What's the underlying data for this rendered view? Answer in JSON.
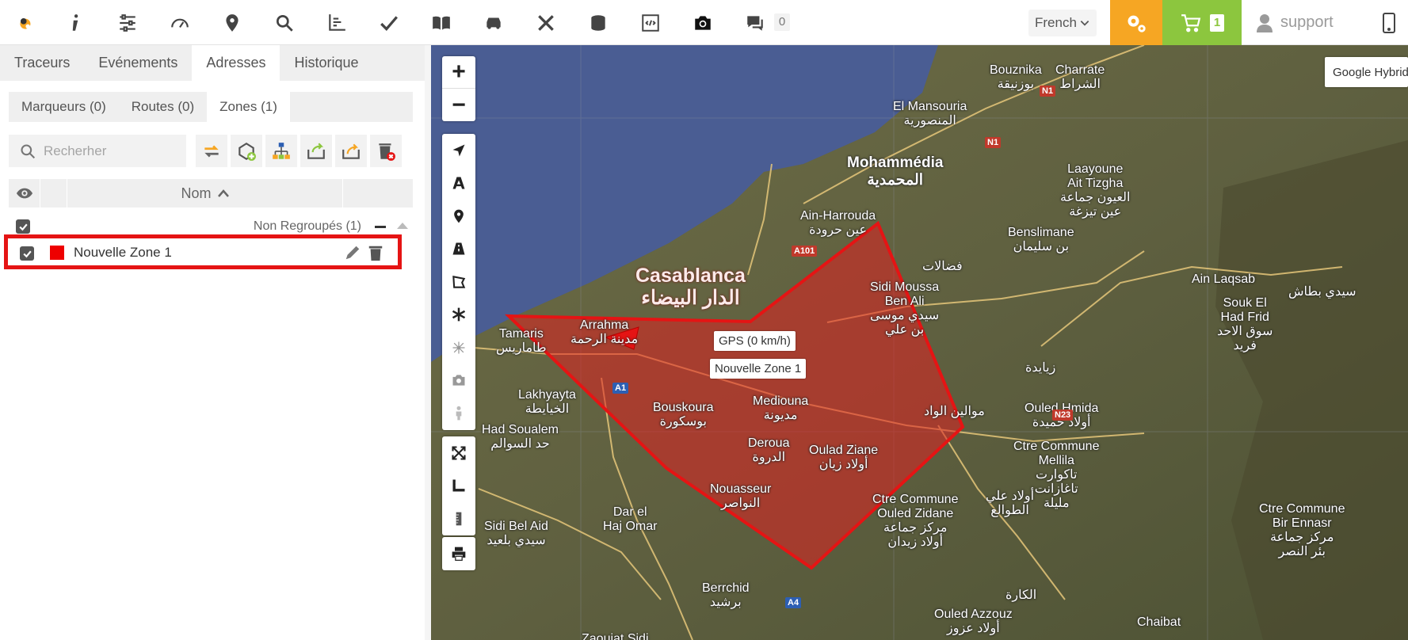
{
  "topbar": {
    "icons": [
      "logo-icon",
      "info-icon",
      "sliders-icon",
      "speedometer-icon",
      "map-pin-icon",
      "search-icon",
      "chart-axes-icon",
      "checkmark-icon",
      "book-icon",
      "car-icon",
      "tools-icon",
      "coins-icon",
      "code-icon",
      "camera-icon",
      "chat-icon"
    ],
    "notifications_count": "0",
    "language": "French",
    "cart_count": "1",
    "username": "support",
    "colors": {
      "config": "#f6a623",
      "cart": "#8cc63e"
    }
  },
  "sidebar": {
    "main_tabs": [
      "Traceurs",
      "Evénements",
      "Adresses",
      "Historique"
    ],
    "active_main_tab": "Adresses",
    "sub_tabs": [
      "Marqueurs (0)",
      "Routes (0)",
      "Zones (1)"
    ],
    "active_sub_tab": "Zones (1)",
    "search_placeholder": "Recherher",
    "toolbar_icons": [
      "refresh-icon",
      "add-zone-icon",
      "hierarchy-icon",
      "import-icon",
      "export-icon",
      "delete-all-icon"
    ],
    "list_header": {
      "name_col": "Nom",
      "sort": "ascending"
    },
    "group": {
      "label": "Non Regroupés (1)",
      "checked": true
    },
    "zones": [
      {
        "name": "Nouvelle Zone 1",
        "color": "#ee0000",
        "checked": true
      }
    ]
  },
  "map": {
    "map_type": "Google Hybrid",
    "toolbar_icons": [
      "locate-arrow-icon",
      "text-icon",
      "marker-icon",
      "road-icon",
      "polygon-icon",
      "asterisk-icon",
      "network-icon",
      "camera-icon",
      "person-icon"
    ],
    "extra_tools": [
      "fullscreen-icon",
      "ruler-icon",
      "measure-icon"
    ],
    "print_icon": "printer-icon",
    "zoom_in": "+",
    "zoom_out": "−",
    "vehicle_tooltip": "GPS (0 km/h)",
    "zone_tooltip": "Nouvelle Zone 1",
    "place_labels": [
      {
        "id": "bouznika",
        "text": "Bouznika\nبوزنيقة"
      },
      {
        "id": "charrate",
        "text": "Charrate\nالشراط"
      },
      {
        "id": "mansouria",
        "text": "El Mansouria\nالمنصورية"
      },
      {
        "id": "mohammedia",
        "text": "Mohammédia\nالمحمدية"
      },
      {
        "id": "laayoune",
        "text": "Laayoune\nAit Tizgha\nالعيون جماعة\nعين تيزغة"
      },
      {
        "id": "ainharrouda",
        "text": "Ain-Harrouda\nعين حرودة"
      },
      {
        "id": "benslimane",
        "text": "Benslimane\nبن سليمان"
      },
      {
        "id": "fadalat",
        "text": "فضالات"
      },
      {
        "id": "ainlaqsab",
        "text": "Ain Laqsab"
      },
      {
        "id": "soukel",
        "text": "Souk El\nHad Frid\nسوق الاحد\nفريد"
      },
      {
        "id": "sidibettache",
        "text": "سيدي بطاش"
      },
      {
        "id": "sidimoussa",
        "text": "Sidi Moussa\nBen Ali\nسيدي موسى\nبن علي"
      },
      {
        "id": "casablanca",
        "text": "Casablanca\nالدار البيضاء"
      },
      {
        "id": "tamaris",
        "text": "Tamaris\nطاماريس"
      },
      {
        "id": "arrahma",
        "text": "Arrahma\nمدينة الرحمة"
      },
      {
        "id": "zyayda",
        "text": "زيايدة"
      },
      {
        "id": "lakhyayta",
        "text": "Lakhyayta\nالخيايطة"
      },
      {
        "id": "bouskoura",
        "text": "Bouskoura\nبوسكورة"
      },
      {
        "id": "mediouna",
        "text": "Mediouna\nمديونة"
      },
      {
        "id": "mwalin",
        "text": "موالين الواد"
      },
      {
        "id": "ouledhmida",
        "text": "Ouled Hmida\nأولاد حميدة"
      },
      {
        "id": "hadsoualem",
        "text": "Had Soualem\nحد السوالم"
      },
      {
        "id": "deroua",
        "text": "Deroua\nالدروة"
      },
      {
        "id": "ouladziane",
        "text": "Oulad Ziane\nأولاد زيان"
      },
      {
        "id": "ctremellila",
        "text": "Ctre Commune\nMellila\nتاكوارت\nتاغازانت\nمليلة"
      },
      {
        "id": "nouasseur",
        "text": "Nouasseur\nالنواصر"
      },
      {
        "id": "ctreouled",
        "text": "Ctre Commune\nOuled Zidane\nمركز جماعة\nأولاد زيدان"
      },
      {
        "id": "ouladali",
        "text": "أولاد علي\nالطوالع"
      },
      {
        "id": "ctrebir",
        "text": "Ctre Commune\nBir Ennasr\nمركز جماعة\nبئر النصر"
      },
      {
        "id": "darelhaj",
        "text": "Dar el\nHaj Omar"
      },
      {
        "id": "sidibelaid",
        "text": "Sidi Bel Aid\nسيدي بلعيد"
      },
      {
        "id": "berrchid",
        "text": "Berrchid\nبرشيد"
      },
      {
        "id": "lagara",
        "text": "الكارة"
      },
      {
        "id": "ouledazzouz",
        "text": "Ouled Azzouz\nأولاد عزوز"
      },
      {
        "id": "chaibat",
        "text": "Chaibat"
      },
      {
        "id": "zaouiat",
        "text": "Zaouiat Sidi"
      }
    ],
    "road_badges": [
      {
        "id": "n1a",
        "text": "N1"
      },
      {
        "id": "n1b",
        "text": "N1"
      },
      {
        "id": "a101",
        "text": "A101"
      },
      {
        "id": "a1",
        "text": "A1"
      },
      {
        "id": "n23",
        "text": "N23"
      },
      {
        "id": "a4",
        "text": "A4"
      }
    ]
  }
}
